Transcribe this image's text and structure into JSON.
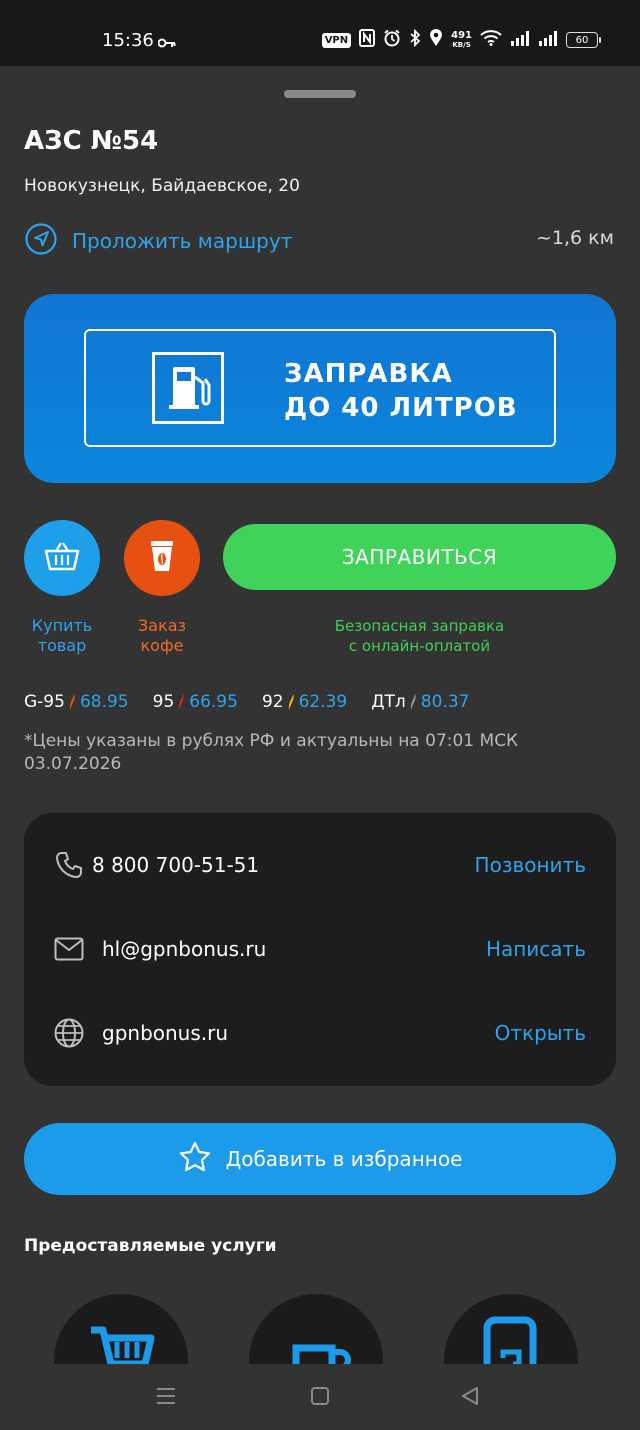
{
  "status_bar": {
    "time": "15:36",
    "vpn": "VPN",
    "net_speed_value": "491",
    "net_speed_unit": "KB/S",
    "battery": "60",
    "icons": [
      "key-icon",
      "nfc-icon",
      "alarm-icon",
      "bluetooth-icon",
      "location-icon",
      "wifi-icon",
      "signal-icon",
      "signal-icon"
    ]
  },
  "station": {
    "title": "АЗС №54",
    "address": "Новокузнецк, Байдаевское, 20",
    "route_label": "Проложить маршрут",
    "distance": "~1,6 км"
  },
  "banner": {
    "line1": "ЗАПРАВКА",
    "line2": "ДО 40 ЛИТРОВ",
    "icon": "fuel-pump-icon"
  },
  "actions": {
    "buy_label_1": "Купить",
    "buy_label_2": "товар",
    "coffee_label_1": "Заказ",
    "coffee_label_2": "кофе",
    "refuel_label": "ЗАПРАВИТЬСЯ",
    "refuel_sub_1": "Безопасная заправка",
    "refuel_sub_2": "с онлайн-оплатой"
  },
  "prices": [
    {
      "name": "G-95",
      "price": "68.95",
      "color": "#e8500f"
    },
    {
      "name": "95",
      "price": "66.95",
      "color": "#e02222"
    },
    {
      "name": "92",
      "price": "62.39",
      "color": "#f2b80c"
    },
    {
      "name": "ДТл",
      "price": "80.37",
      "color": "#9a9a9a"
    }
  ],
  "price_note": "*Цены указаны в рублях РФ и актуальны на 07:01 МСК 03.07.2026",
  "contacts": {
    "phone": "8 800 700-51-51",
    "phone_action": "Позвонить",
    "email": "hl@gpnbonus.ru",
    "email_action": "Написать",
    "site": "gpnbonus.ru",
    "site_action": "Открыть"
  },
  "favorite_label": "Добавить в избранное",
  "services_title": "Предоставляемые услуги",
  "colors": {
    "accent_blue": "#2ea3ec",
    "green": "#3fd35a",
    "orange": "#e8500f",
    "background": "#333333",
    "card": "#1d1d1d"
  }
}
